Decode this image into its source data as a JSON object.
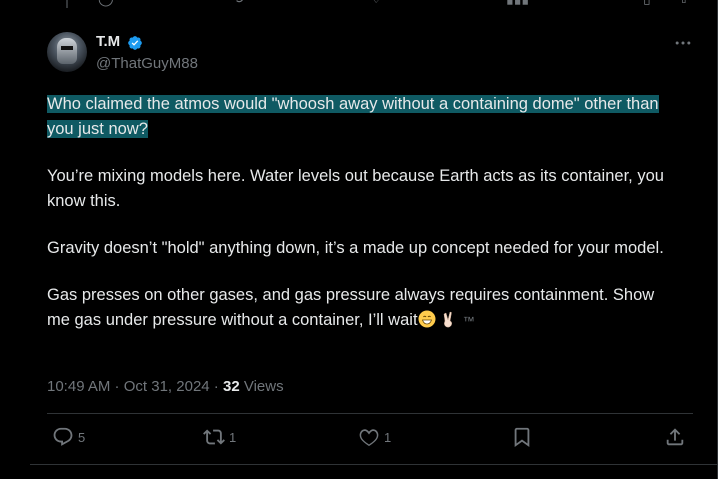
{
  "author": {
    "name": "T.M",
    "handle": "@ThatGuyM88"
  },
  "tweet": {
    "highlighted": "Who claimed the atmos would \"whoosh away without a containing dome\" other than you just now?",
    "p2": "You’re mixing models here. Water levels out because Earth acts as its container, you know this.",
    "p3": "Gravity doesn’t \"hold\" anything down, it’s a made up concept needed for your model.",
    "p4": "Gas presses on other gases, and gas pressure always requires containment. Show me gas under pressure without a container, I’ll wait",
    "emojis": [
      "grinning-face-icon",
      "victory-hand-icon"
    ],
    "tm": "™"
  },
  "meta": {
    "time": "10:49 AM",
    "sep1": " · ",
    "date": "Oct 31, 2024",
    "sep2": " · ",
    "views_count": "32",
    "views_label": " Views"
  },
  "actions": {
    "replies": "5",
    "reposts": "1",
    "likes": "1"
  },
  "colors": {
    "background": "#000000",
    "text": "#e7e9ea",
    "muted": "#71767b",
    "highlight": "#0f5a63",
    "verified": "#1d9bf0"
  }
}
